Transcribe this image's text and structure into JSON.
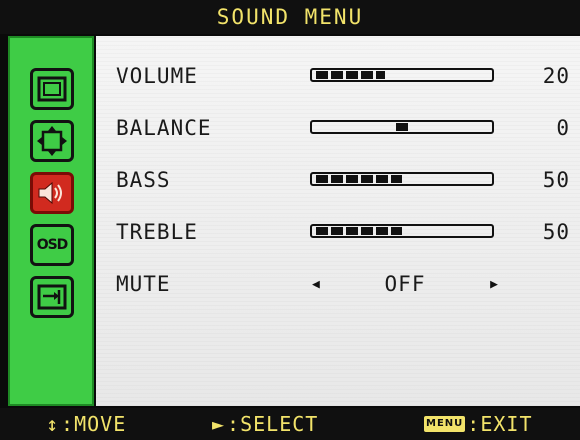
{
  "title": "SOUND MENU",
  "sidebar": {
    "items": [
      {
        "icon": "picture-icon",
        "active": false
      },
      {
        "icon": "geometry-icon",
        "active": false
      },
      {
        "icon": "speaker-icon",
        "active": true
      },
      {
        "icon": "osd-icon",
        "label": "OSD",
        "active": false
      },
      {
        "icon": "exit-input-icon",
        "active": false
      }
    ]
  },
  "settings": [
    {
      "label": "VOLUME",
      "value": "20",
      "level": 0.4
    },
    {
      "label": "BALANCE",
      "value": "0",
      "position": 0.5
    },
    {
      "label": "BASS",
      "value": "50",
      "level": 0.5
    },
    {
      "label": "TREBLE",
      "value": "50",
      "level": 0.5
    }
  ],
  "mute": {
    "label": "MUTE",
    "value": "OFF"
  },
  "footer": {
    "move": ":MOVE",
    "select": ":SELECT",
    "menu_key": "MENU",
    "exit": ":EXIT"
  },
  "colors": {
    "accent_yellow": "#f2e36a",
    "sidebar_green": "#3fcc46",
    "active_red": "#d12a1f",
    "panel": "#f0f0f0"
  }
}
